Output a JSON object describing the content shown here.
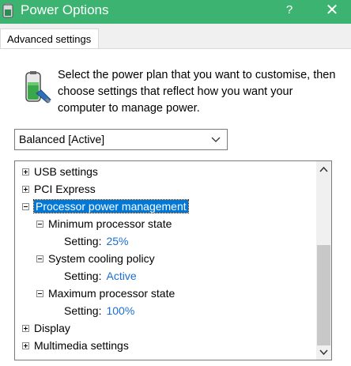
{
  "window": {
    "title": "Power Options",
    "help_label": "?",
    "close_label": "✕",
    "accent_color": "#3cb371"
  },
  "tab": {
    "label": "Advanced settings"
  },
  "description": "Select the power plan that you want to customise, then choose settings that reflect how you want your computer to manage power.",
  "plan_select": {
    "value": "Balanced [Active]"
  },
  "tree": {
    "items": [
      {
        "label": "USB settings"
      },
      {
        "label": "PCI Express"
      },
      {
        "label": "Processor power management"
      },
      {
        "label": "Minimum processor state"
      },
      {
        "setting_label": "Setting:",
        "setting_value": "25%"
      },
      {
        "label": "System cooling policy"
      },
      {
        "setting_label": "Setting:",
        "setting_value": "Active"
      },
      {
        "label": "Maximum processor state"
      },
      {
        "setting_label": "Setting:",
        "setting_value": "100%"
      },
      {
        "label": "Display"
      },
      {
        "label": "Multimedia settings"
      }
    ]
  },
  "icons": {
    "app": "power-options-icon",
    "battery": "battery-plug-icon",
    "expand": "plus-box-icon",
    "collapse": "minus-box-icon"
  },
  "colors": {
    "selection": "#0078d7",
    "value_link": "#1a6fd0"
  }
}
